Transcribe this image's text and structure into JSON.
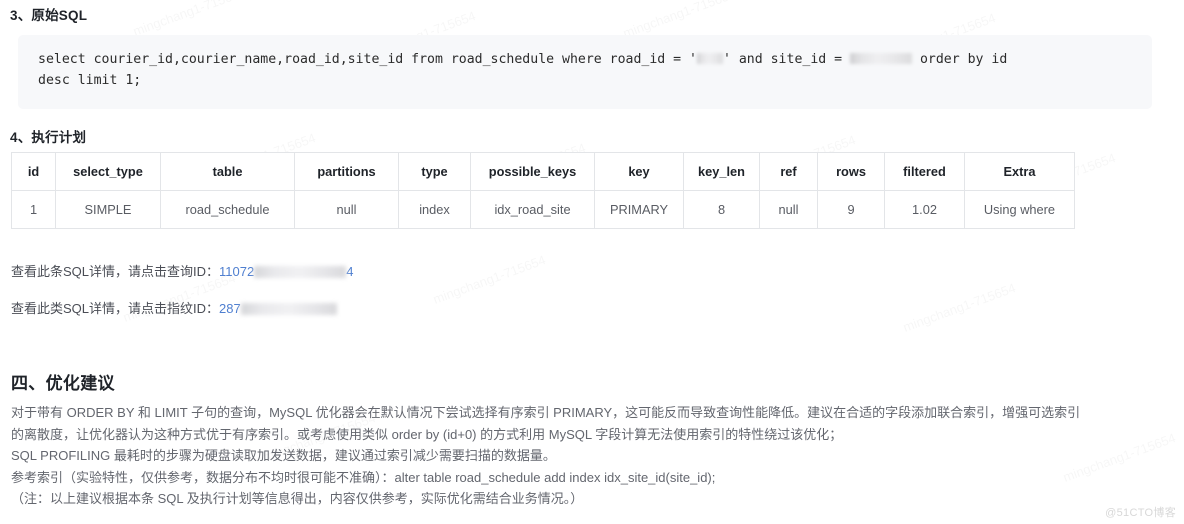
{
  "sections": {
    "raw_sql_heading": "3、原始SQL",
    "plan_heading": "4、执行计划",
    "advice_heading": "四、优化建议"
  },
  "sql": {
    "line1_a": "select courier_id,courier_name,road_id,site_id from road_schedule where road_id = '",
    "line1_b": "' and site_id = ",
    "line1_c": " order by id",
    "line2": "desc limit 1;",
    "redacted_road_id": "",
    "redacted_site_id": ""
  },
  "explain_plan": {
    "columns": [
      "id",
      "select_type",
      "table",
      "partitions",
      "type",
      "possible_keys",
      "key",
      "key_len",
      "ref",
      "rows",
      "filtered",
      "Extra"
    ],
    "rows": [
      [
        "1",
        "SIMPLE",
        "road_schedule",
        "null",
        "index",
        "idx_road_site",
        "PRIMARY",
        "8",
        "null",
        "9",
        "1.02",
        "Using where"
      ]
    ]
  },
  "links": {
    "query_prefix": "查看此条SQL详情，请点击查询ID：",
    "query_id_visible_start": "11072",
    "query_id_visible_end": "4",
    "fingerprint_prefix": "查看此类SQL详情，请点击指纹ID：",
    "fingerprint_id_visible_start": "287",
    "fingerprint_id_visible_end": "",
    "link_color": "#4f7fd0"
  },
  "advice": {
    "p1_line1": "对于带有 ORDER BY 和 LIMIT 子句的查询，MySQL 优化器会在默认情况下尝试选择有序索引 PRIMARY，这可能反而导致查询性能降低。建议在合适的字段添加联合索引，增强可选索引",
    "p1_line2": "的离散度，让优化器认为这种方式优于有序索引。或考虑使用类似 order by (id+0) 的方式利用 MySQL 字段计算无法使用索引的特性绕过该优化；",
    "p2_line1": "SQL PROFILING 最耗时的步骤为硬盘读取加发送数据，建议通过索引减少需要扫描的数据量。",
    "p2_line2": "参考索引（实验特性，仅供参考，数据分布不均时很可能不准确）：alter table road_schedule add index idx_site_id(site_id);",
    "p2_line3": "（注：以上建议根据本条 SQL 及执行计划等信息得出，内容仅供参考，实际优化需结合业务情况。）"
  },
  "watermark": {
    "corner": "@51CTO博客",
    "page": "mingchang1-715654"
  }
}
